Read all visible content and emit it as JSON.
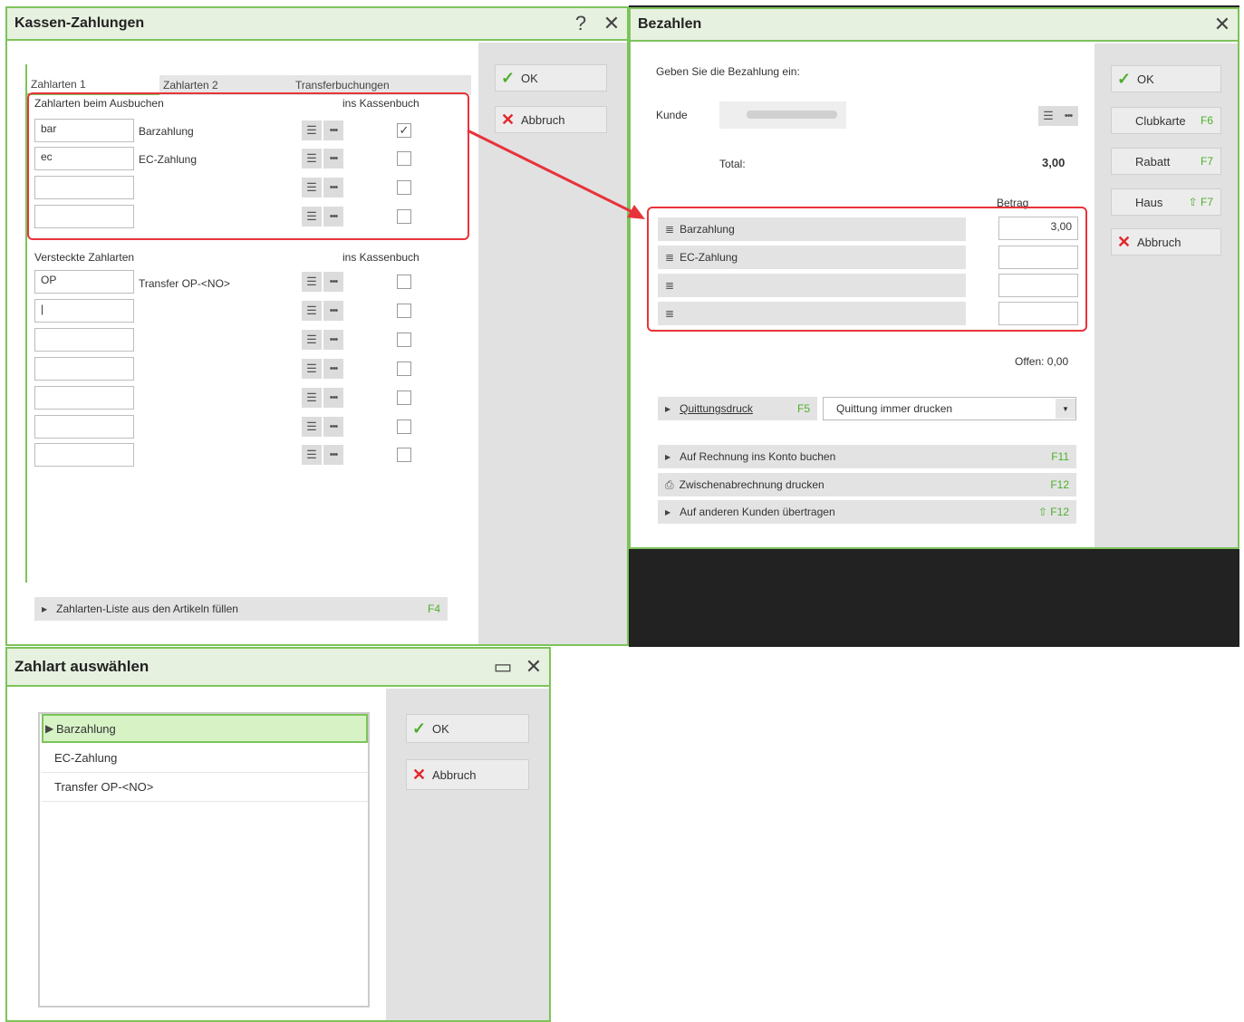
{
  "kassen": {
    "title": "Kassen-Zahlungen",
    "help": "?",
    "close": "✕",
    "tabs": [
      "Zahlarten 1",
      "Zahlarten 2",
      "Transferbuchungen"
    ],
    "section1": {
      "heading": "Zahlarten beim Ausbuchen",
      "col": "ins Kassenbuch"
    },
    "section2": {
      "heading": "Versteckte Zahlarten",
      "col": "ins Kassenbuch"
    },
    "rows1": [
      {
        "code": "bar",
        "name": "Barzahlung",
        "checked": "✓"
      },
      {
        "code": "ec",
        "name": "EC-Zahlung",
        "checked": ""
      },
      {
        "code": "",
        "name": "",
        "checked": ""
      },
      {
        "code": "",
        "name": "",
        "checked": ""
      }
    ],
    "rows2": [
      {
        "code": "OP",
        "name": "Transfer OP-<NO>"
      },
      {
        "code": "|",
        "name": ""
      }
    ],
    "fill_bar": "Zahlarten-Liste aus den Artikeln füllen",
    "fill_key": "F4",
    "ok": "OK",
    "cancel": "Abbruch"
  },
  "bezahlen": {
    "title": "Bezahlen",
    "close": "✕",
    "prompt": "Geben Sie die Bezahlung ein:",
    "kunde_label": "Kunde",
    "total_label": "Total:",
    "total_value": "3,00",
    "betrag_label": "Betrag",
    "payments": [
      {
        "name": "Barzahlung",
        "amount": "3,00"
      },
      {
        "name": "EC-Zahlung",
        "amount": ""
      },
      {
        "name": "",
        "amount": ""
      },
      {
        "name": "",
        "amount": ""
      }
    ],
    "offen": "Offen: 0,00",
    "quittung_label": "Quittungsdruck",
    "quittung_key": "F5",
    "quittung_select": "Quittung immer drucken",
    "bar1": "Auf Rechnung ins Konto buchen",
    "bar1_key": "F11",
    "bar2": "Zwischenabrechnung drucken",
    "bar2_key": "F12",
    "bar3": "Auf anderen Kunden übertragen",
    "bar3_key": "⇧ F12",
    "ok": "OK",
    "clubkarte": "Clubkarte",
    "clubkarte_key": "F6",
    "rabatt": "Rabatt",
    "rabatt_key": "F7",
    "haus": "Haus",
    "haus_key": "⇧ F7",
    "cancel": "Abbruch"
  },
  "zahlart": {
    "title": "Zahlart auswählen",
    "maximize": "▭",
    "close": "✕",
    "items": [
      "Barzahlung",
      "EC-Zahlung",
      "Transfer OP-<NO>"
    ],
    "ok": "OK",
    "cancel": "Abbruch"
  },
  "colors": {
    "accent": "#7dc35b",
    "highlight": "#e8333a",
    "ok": "#4caf2a",
    "cancel": "#e3262a"
  }
}
